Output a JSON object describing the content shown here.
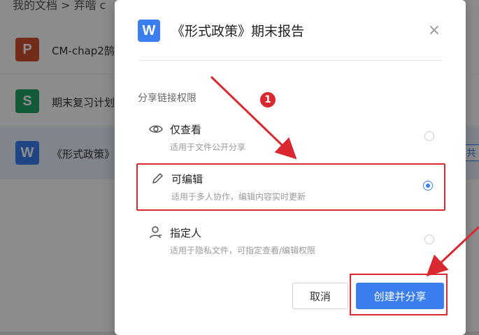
{
  "background": {
    "breadcrumb": "我的文档 > 弃喈 c",
    "files": [
      {
        "name": "CM-chap2鹄",
        "icon_letter": "P",
        "icon_color": "#d2502f"
      },
      {
        "name": "期末复习计划",
        "icon_letter": "S",
        "icon_color": "#21a366"
      },
      {
        "name": "《形式政策》",
        "icon_letter": "W",
        "icon_color": "#3b7ef0"
      }
    ],
    "share_tag": "共"
  },
  "modal": {
    "badge_letter": "W",
    "title": "《形式政策》期末报告",
    "close_label": "×",
    "section_label": "分享链接权限",
    "options": [
      {
        "title": "仅查看",
        "desc": "适用于文件公开分享",
        "icon": "eye-icon",
        "selected": false
      },
      {
        "title": "可编辑",
        "desc": "适用于多人协作，编辑内容实时更新",
        "icon": "pencil-icon",
        "selected": true
      },
      {
        "title": "指定人",
        "desc": "适用于隐私文件，可指定查看/编辑权限",
        "icon": "person-icon",
        "selected": false
      }
    ],
    "cancel_label": "取消",
    "confirm_label": "创建并分享"
  },
  "annotation": {
    "step_number": "1",
    "color": "#d9282f"
  },
  "colors": {
    "accent": "#3b7ef0",
    "annotation_red": "#d9282f"
  }
}
